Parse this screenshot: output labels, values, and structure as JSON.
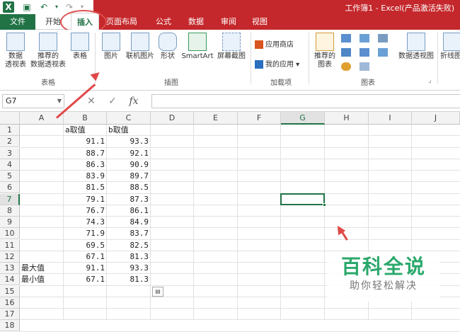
{
  "window": {
    "title": "工作簿1 - Excel(产品激活失败)"
  },
  "tabs": {
    "file": "文件",
    "home": "开始",
    "insert": "插入",
    "page_layout": "页面布局",
    "formulas": "公式",
    "data": "数据",
    "review": "审阅",
    "view": "视图"
  },
  "ribbon": {
    "tables": {
      "pivot": "数据\n透视表",
      "recommended_pivot": "推荐的\n数据透视表",
      "table": "表格",
      "group": "表格"
    },
    "illustrations": {
      "picture": "图片",
      "online_picture": "联机图片",
      "shapes": "形状",
      "smartart": "SmartArt",
      "screenshot": "屏幕截图",
      "group": "插图"
    },
    "addins": {
      "store": "应用商店",
      "my_apps": "我的应用",
      "group": "加载项"
    },
    "charts": {
      "recommended": "推荐的\n图表",
      "pivot_chart": "数据透视图",
      "group": "图表"
    },
    "sparklines": {
      "line": "折线图"
    }
  },
  "formula_bar": {
    "name_box": "G7",
    "fx": "fx",
    "value": ""
  },
  "sheet": {
    "columns": [
      "A",
      "B",
      "C",
      "D",
      "E",
      "F",
      "G",
      "H",
      "I",
      "J"
    ],
    "selected_column": "G",
    "selected_row": 7,
    "rows": [
      {
        "n": "1",
        "a": "",
        "b": "a取值",
        "c": "b取值"
      },
      {
        "n": "2",
        "a": "",
        "b": "91.1",
        "c": "93.3"
      },
      {
        "n": "3",
        "a": "",
        "b": "88.7",
        "c": "92.1"
      },
      {
        "n": "4",
        "a": "",
        "b": "86.3",
        "c": "90.9"
      },
      {
        "n": "5",
        "a": "",
        "b": "83.9",
        "c": "89.7"
      },
      {
        "n": "6",
        "a": "",
        "b": "81.5",
        "c": "88.5"
      },
      {
        "n": "7",
        "a": "",
        "b": "79.1",
        "c": "87.3"
      },
      {
        "n": "8",
        "a": "",
        "b": "76.7",
        "c": "86.1"
      },
      {
        "n": "9",
        "a": "",
        "b": "74.3",
        "c": "84.9"
      },
      {
        "n": "10",
        "a": "",
        "b": "71.9",
        "c": "83.7"
      },
      {
        "n": "11",
        "a": "",
        "b": "69.5",
        "c": "82.5"
      },
      {
        "n": "12",
        "a": "",
        "b": "67.1",
        "c": "81.3"
      },
      {
        "n": "13",
        "a": "最大值",
        "b": "91.1",
        "c": "93.3"
      },
      {
        "n": "14",
        "a": "最小值",
        "b": "67.1",
        "c": "81.3"
      },
      {
        "n": "15",
        "a": "",
        "b": "",
        "c": ""
      },
      {
        "n": "16",
        "a": "",
        "b": "",
        "c": ""
      },
      {
        "n": "17",
        "a": "",
        "b": "",
        "c": ""
      },
      {
        "n": "18",
        "a": "",
        "b": "",
        "c": ""
      }
    ]
  },
  "watermark": {
    "title": "百科全说",
    "subtitle": "助你轻松解决"
  },
  "colors": {
    "excel_green": "#217346",
    "title_red": "#c4282c",
    "annotation_red": "#e04848",
    "watermark_green": "#2aa86b"
  }
}
